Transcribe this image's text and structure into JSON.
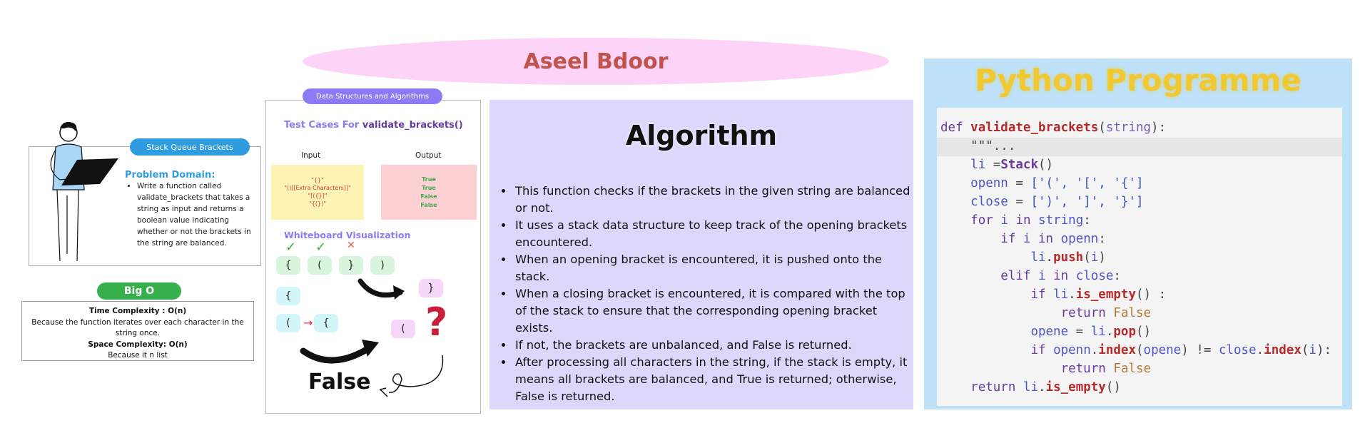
{
  "title": "Aseel Bdoor",
  "intro": {
    "tag": "Stack Queue Brackets",
    "problem_title": "Problem Domain:",
    "problem_text": "Write a function called validate_brackets that takes a string as input and returns a boolean value indicating whether or not the brackets in the string are balanced."
  },
  "big_o": {
    "label": "Big O",
    "time_label": "Time Complexity : O(n)",
    "time_text": "Because the function iterates over each character in the string once.",
    "space_label": "Space Complexity: O(n)",
    "space_text": "Because it n list"
  },
  "test_cases": {
    "pill": "Data Structures and Algorithms",
    "title_prefix": "Test Cases For ",
    "title_fn": "validate_brackets()",
    "input_head": "Input",
    "output_head": "Output",
    "inputs": [
      "\"{}\"",
      "\"()[[Extra Characters]]\"",
      "\"[({}]\"",
      "\"{(})\""
    ],
    "outputs": [
      "True",
      "True",
      "False",
      "False"
    ],
    "whiteboard_title": "Whiteboard Visualization",
    "chips_row1": [
      "{",
      "(",
      "}",
      ")"
    ],
    "chip_stack": "{",
    "chip_pop": "}",
    "chip_a": "(",
    "chip_b": "{",
    "chip_c": "(",
    "arrow": "→",
    "false_label": "False",
    "colors": {
      "check": "#3daa4f",
      "cross": "#e0604f",
      "question": "#c8203a"
    }
  },
  "algorithm": {
    "title": "Algorithm",
    "points": [
      "This function checks if the brackets in the given string are balanced or not.",
      "It uses a stack data structure to keep track of the opening brackets encountered.",
      "When an opening bracket is encountered, it is pushed onto the stack.",
      "When a closing bracket is encountered, it is compared with the top of the stack to ensure that the corresponding opening bracket exists.",
      "If not, the brackets are unbalanced, and False is returned.",
      "After processing all characters in the string, if the stack is empty, it means all brackets are balanced, and True is returned; otherwise, False is returned."
    ]
  },
  "python": {
    "title": "Python Programme"
  }
}
